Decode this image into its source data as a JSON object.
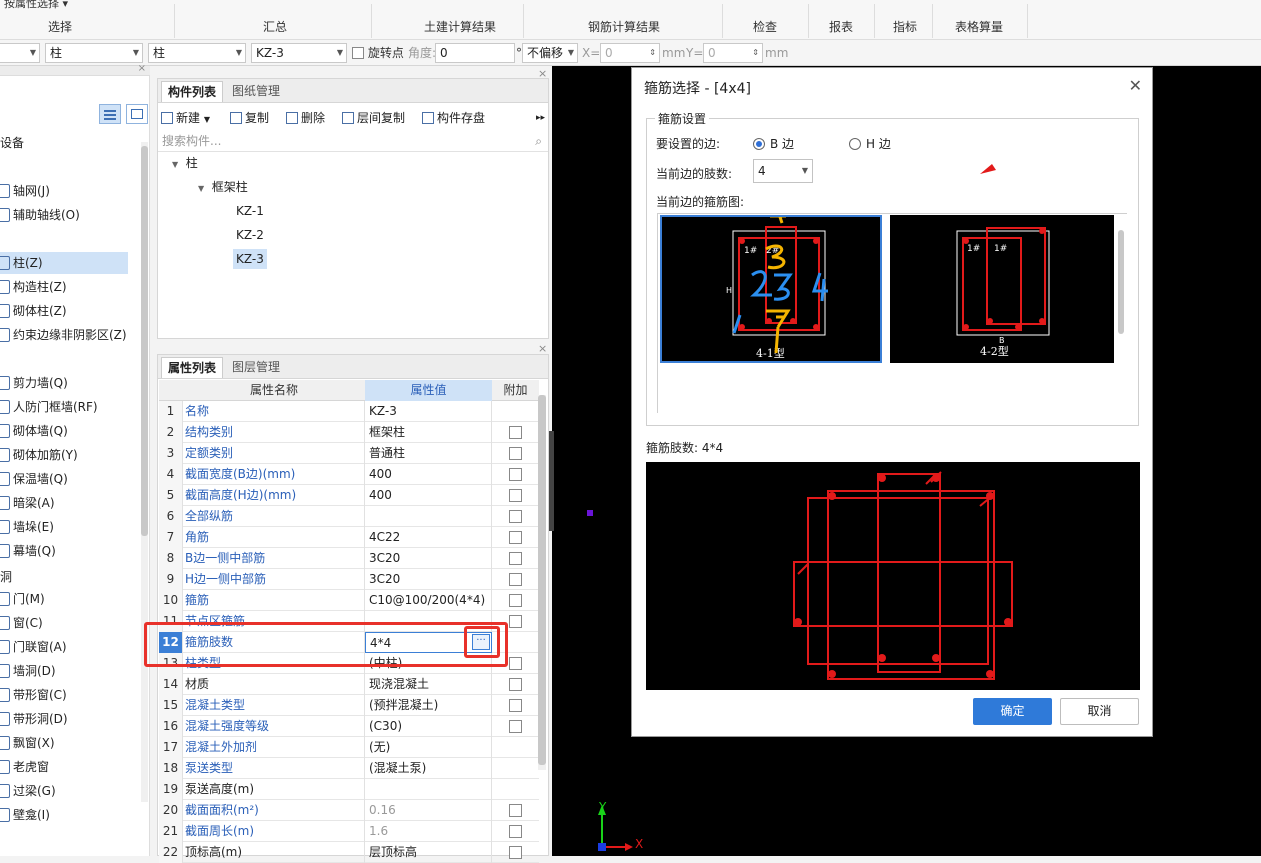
{
  "ribbon": {
    "top_text": "按属性选择",
    "groups": [
      "选择",
      "汇总",
      "土建计算结果",
      "钢筋计算结果",
      "检查",
      "报表",
      "指标",
      "表格算量"
    ]
  },
  "toolbar": {
    "dd1": "",
    "dd2": "柱",
    "dd3": "柱",
    "dd4": "KZ-3",
    "rotate_label": "旋转点",
    "angle_label": "角度:",
    "angle_value": "0",
    "degree": "°",
    "offset": "不偏移",
    "x_label": "X=",
    "x_value": "0",
    "mm1": "mm",
    "y_label": "Y=",
    "y_value": "0",
    "mm2": "mm"
  },
  "nav": {
    "top_partial": "设备",
    "items": [
      {
        "label": "轴网(J)",
        "icon": "axis-grid-icon"
      },
      {
        "label": "辅助轴线(O)",
        "icon": "aux-axis-icon"
      },
      {
        "label": "柱(Z)",
        "icon": "column-icon",
        "selected": true
      },
      {
        "label": "构造柱(Z)",
        "icon": "structural-column-icon"
      },
      {
        "label": "砌体柱(Z)",
        "icon": "masonry-column-icon"
      },
      {
        "label": "约束边缘非阴影区(Z)",
        "icon": "constraint-edge-icon"
      },
      {
        "label": "剪力墙(Q)",
        "icon": "shear-wall-icon"
      },
      {
        "label": "人防门框墙(RF)",
        "icon": "civil-door-wall-icon"
      },
      {
        "label": "砌体墙(Q)",
        "icon": "masonry-wall-icon"
      },
      {
        "label": "砌体加筋(Y)",
        "icon": "masonry-rebar-icon"
      },
      {
        "label": "保温墙(Q)",
        "icon": "insulation-wall-icon"
      },
      {
        "label": "暗梁(A)",
        "icon": "hidden-beam-icon"
      },
      {
        "label": "墙垛(E)",
        "icon": "wall-pier-icon"
      },
      {
        "label": "幕墙(Q)",
        "icon": "curtain-wall-icon"
      },
      {
        "label": "门(M)",
        "icon": "door-icon"
      },
      {
        "label": "窗(C)",
        "icon": "window-icon"
      },
      {
        "label": "门联窗(A)",
        "icon": "door-window-icon"
      },
      {
        "label": "墙洞(D)",
        "icon": "wall-hole-icon"
      },
      {
        "label": "带形窗(C)",
        "icon": "strip-window-icon"
      },
      {
        "label": "带形洞(D)",
        "icon": "strip-hole-icon"
      },
      {
        "label": "飘窗(X)",
        "icon": "bay-window-icon"
      },
      {
        "label": "老虎窗",
        "icon": "dormer-icon"
      },
      {
        "label": "过梁(G)",
        "icon": "lintel-icon"
      },
      {
        "label": "壁龛(I)",
        "icon": "niche-icon"
      }
    ],
    "section_door": "洞"
  },
  "component_panel": {
    "tab_active": "构件列表",
    "tab_inactive": "图纸管理",
    "buttons": {
      "new": "新建",
      "copy": "复制",
      "delete": "删除",
      "floor_copy": "层间复制",
      "save": "构件存盘"
    },
    "search_placeholder": "搜索构件...",
    "tree": {
      "root": "柱",
      "group": "框架柱",
      "items": [
        "KZ-1",
        "KZ-2",
        "KZ-3"
      ]
    }
  },
  "property_panel": {
    "tab_active": "属性列表",
    "tab_inactive": "图层管理",
    "headers": {
      "name": "属性名称",
      "value": "属性值",
      "extra": "附加"
    },
    "rows": [
      {
        "n": "1",
        "name": "名称",
        "value": "KZ-3",
        "check": false
      },
      {
        "n": "2",
        "name": "结构类别",
        "value": "框架柱",
        "check": true
      },
      {
        "n": "3",
        "name": "定额类别",
        "value": "普通柱",
        "check": true
      },
      {
        "n": "4",
        "name": "截面宽度(B边)(mm)",
        "value": "400",
        "check": true
      },
      {
        "n": "5",
        "name": "截面高度(H边)(mm)",
        "value": "400",
        "check": true
      },
      {
        "n": "6",
        "name": "全部纵筋",
        "value": "",
        "check": true
      },
      {
        "n": "7",
        "name": "角筋",
        "value": "4C22",
        "check": true
      },
      {
        "n": "8",
        "name": "B边一侧中部筋",
        "value": "3C20",
        "check": true
      },
      {
        "n": "9",
        "name": "H边一侧中部筋",
        "value": "3C20",
        "check": true
      },
      {
        "n": "10",
        "name": "箍筋",
        "value": "C10@100/200(4*4)",
        "check": true
      },
      {
        "n": "11",
        "name": "节点区箍筋",
        "value": "",
        "check": true
      },
      {
        "n": "12",
        "name": "箍筋肢数",
        "value": "4*4",
        "check": false,
        "selected": true
      },
      {
        "n": "13",
        "name": "柱类型",
        "value": "(中柱)",
        "check": true
      },
      {
        "n": "14",
        "name": "材质",
        "value": "现浇混凝土",
        "check": true,
        "black": true
      },
      {
        "n": "15",
        "name": "混凝土类型",
        "value": "(预拌混凝土)",
        "check": true
      },
      {
        "n": "16",
        "name": "混凝土强度等级",
        "value": "(C30)",
        "check": true
      },
      {
        "n": "17",
        "name": "混凝土外加剂",
        "value": "(无)",
        "check": false
      },
      {
        "n": "18",
        "name": "泵送类型",
        "value": "(混凝土泵)",
        "check": false
      },
      {
        "n": "19",
        "name": "泵送高度(m)",
        "value": "",
        "check": false,
        "black": true
      },
      {
        "n": "20",
        "name": "截面面积(m²)",
        "value": "0.16",
        "check": true,
        "grey": true
      },
      {
        "n": "21",
        "name": "截面周长(m)",
        "value": "1.6",
        "check": true,
        "grey": true
      },
      {
        "n": "22",
        "name": "顶标高(m)",
        "value": "层顶标高",
        "check": true,
        "black": true
      }
    ]
  },
  "dialog": {
    "title": "箍筋选择 - [4x4]",
    "section": "箍筋设置",
    "side_label": "要设置的边:",
    "side_b": "B 边",
    "side_h": "H 边",
    "legs_label": "当前边的肢数:",
    "legs_value": "4",
    "diagram_label": "当前边的箍筋图:",
    "option1_caption": "4-1型",
    "option2_caption": "4-2型",
    "tag_1": "1#",
    "tag_2": "2#",
    "h_mark": "H",
    "b_mark": "B",
    "summary": "箍筋肢数: 4*4",
    "ok": "确定",
    "cancel": "取消"
  },
  "canvas": {
    "axis_x": "X",
    "axis_y": "Y"
  },
  "colors": {
    "accent": "#2f7ad9",
    "rebar_red": "#e21a1a",
    "highlight_red": "#e8312a",
    "annot_blue": "#2b8ff0",
    "annot_orange": "#f5b400"
  }
}
